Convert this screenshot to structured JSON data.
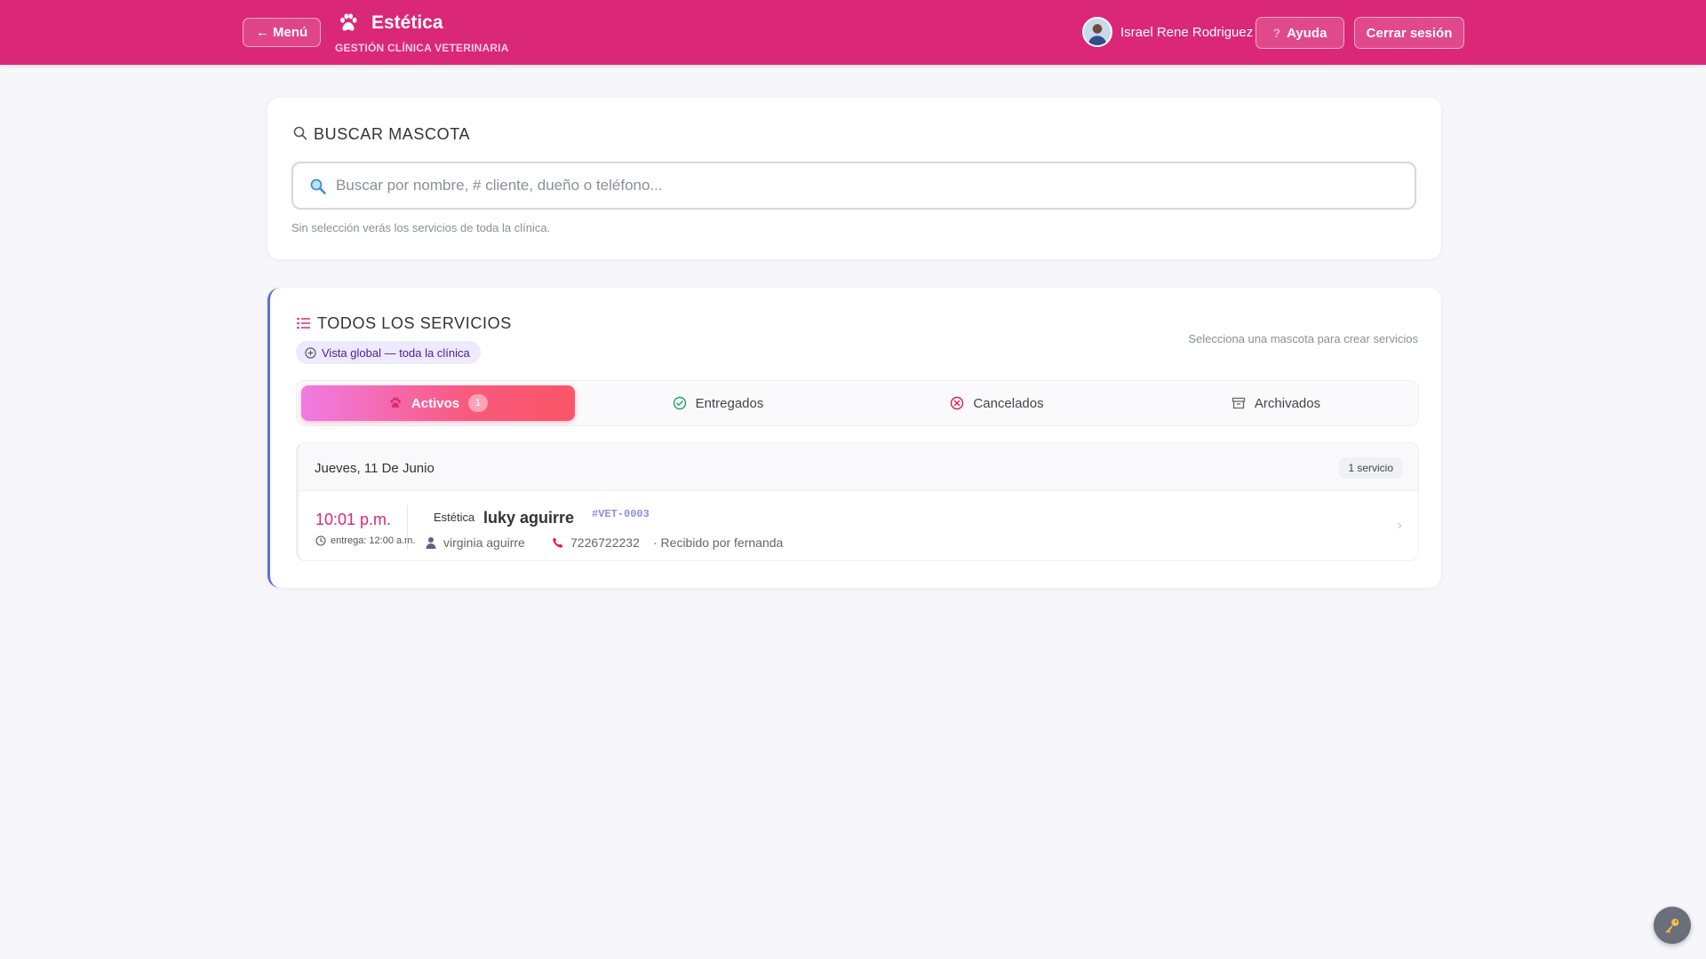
{
  "header": {
    "menu_label": "← Menú",
    "title": "Estética",
    "subtitle": "GESTIÓN CLÍNICA VETERINARIA",
    "user_name": "Israel Rene Rodriguez",
    "help_label": "Ayuda",
    "logout_label": "Cerrar sesión"
  },
  "search": {
    "title": "BUSCAR MASCOTA",
    "placeholder": "Buscar por nombre, # cliente, dueño o teléfono...",
    "value": "",
    "hint": "Sin selección verás los servicios de toda la clínica."
  },
  "services": {
    "title": "TODOS LOS SERVICIOS",
    "global_badge": "Vista global — toda la clínica",
    "right_hint": "Selecciona una mascota para crear servicios",
    "tabs": [
      {
        "label": "Activos",
        "count": "1",
        "active": true,
        "icon": "paw-icon"
      },
      {
        "label": "Entregados",
        "icon": "check-circle-icon"
      },
      {
        "label": "Cancelados",
        "icon": "x-circle-icon"
      },
      {
        "label": "Archivados",
        "icon": "archive-icon"
      }
    ],
    "groups": [
      {
        "date": "Jueves, 11 De Junio",
        "count": "1 servicio",
        "items": [
          {
            "time": "10:01 p.m.",
            "delivery": "entrega: 12:00 a.m.",
            "type": "Estética",
            "pet_name": "luky aguirre",
            "pet_id": "#VET-0003",
            "owner": "virginia aguirre",
            "phone": "7226722232",
            "received": "· Recibido por fernanda"
          }
        ]
      }
    ]
  },
  "colors": {
    "brand": "#db2777",
    "accent_border": "#5b6ee1",
    "background": "#f6f6fb"
  }
}
